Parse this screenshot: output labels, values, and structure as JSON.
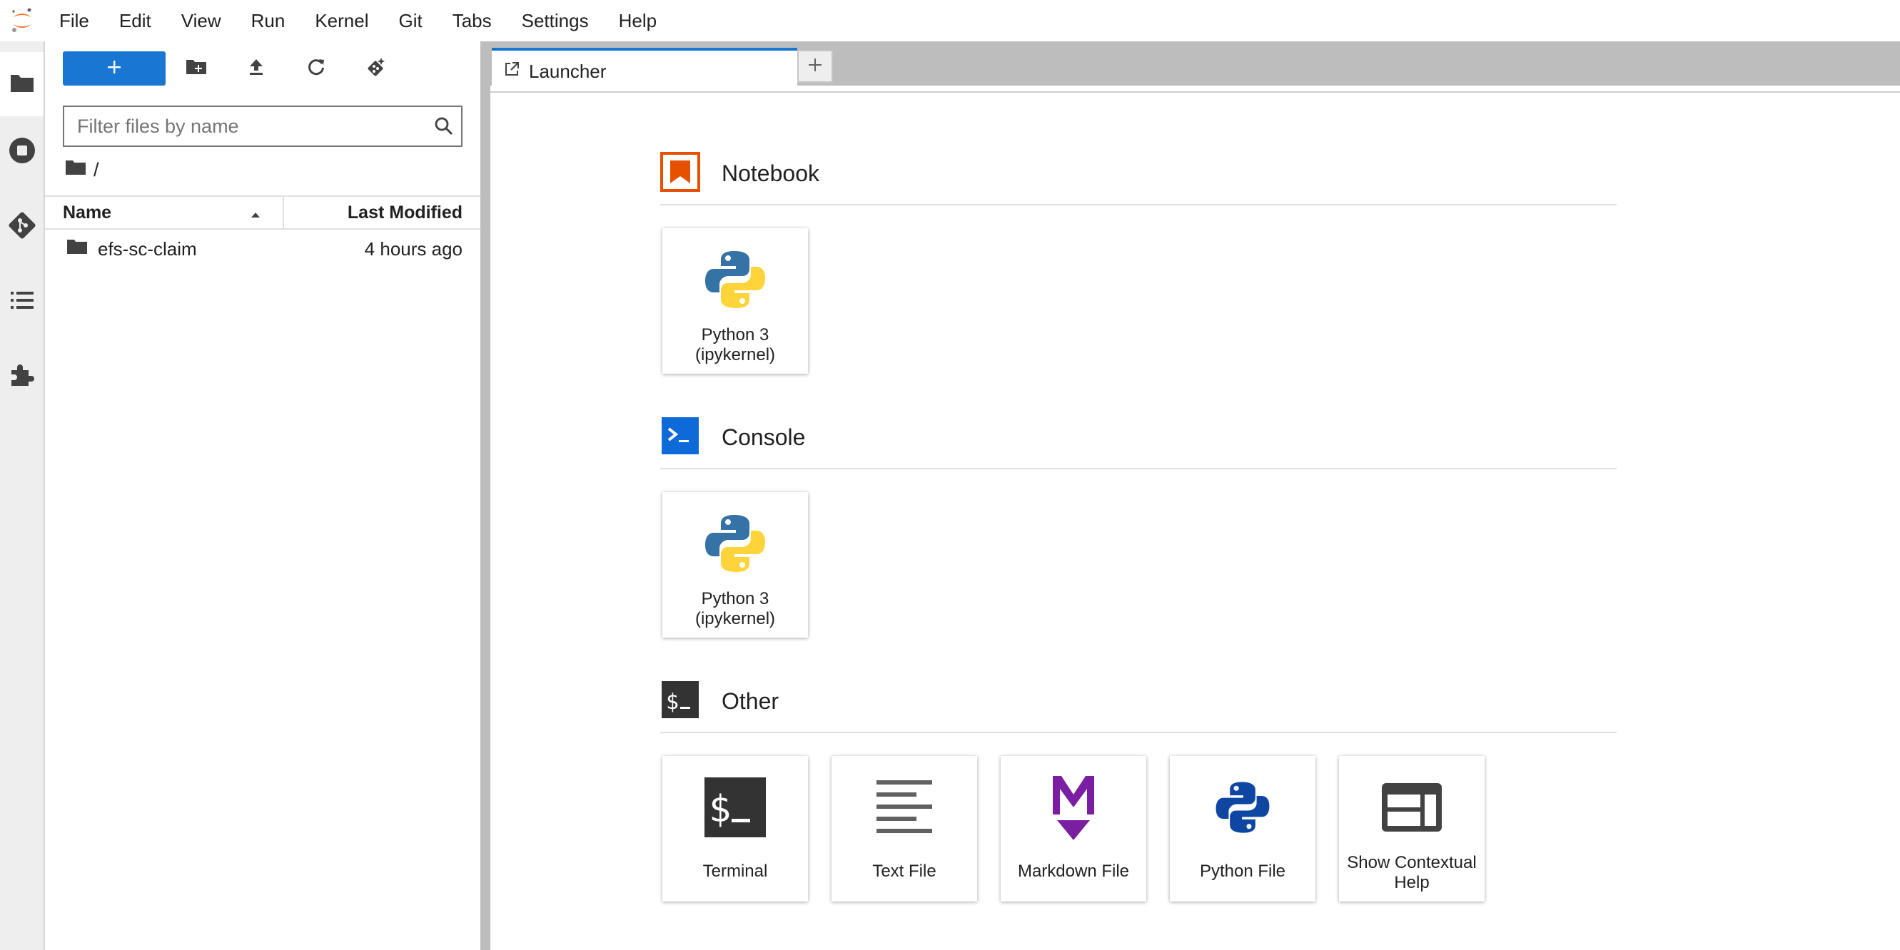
{
  "menu": {
    "items": [
      "File",
      "Edit",
      "View",
      "Run",
      "Kernel",
      "Git",
      "Tabs",
      "Settings",
      "Help"
    ]
  },
  "activity_bar": {
    "icons": [
      "folder-icon",
      "running-icon",
      "git-icon",
      "toc-icon",
      "extensions-icon"
    ]
  },
  "file_browser": {
    "filter_placeholder": "Filter files by name",
    "breadcrumb": "/",
    "columns": {
      "name": "Name",
      "modified": "Last Modified"
    },
    "sort": "name-ascending",
    "rows": [
      {
        "name": "efs-sc-claim",
        "type": "folder",
        "modified": "4 hours ago"
      }
    ]
  },
  "tabs": [
    {
      "label": "Launcher",
      "active": true
    }
  ],
  "launcher": {
    "sections": [
      {
        "title": "Notebook",
        "icon": "notebook-icon",
        "cards": [
          {
            "label": "Python 3 (ipykernel)",
            "icon": "python-logo-icon"
          }
        ]
      },
      {
        "title": "Console",
        "icon": "console-icon",
        "cards": [
          {
            "label": "Python 3 (ipykernel)",
            "icon": "python-logo-icon"
          }
        ]
      },
      {
        "title": "Other",
        "icon": "terminal-section-icon",
        "cards": [
          {
            "label": "Terminal",
            "icon": "terminal-icon"
          },
          {
            "label": "Text File",
            "icon": "text-file-icon"
          },
          {
            "label": "Markdown File",
            "icon": "markdown-icon"
          },
          {
            "label": "Python File",
            "icon": "python-file-icon"
          },
          {
            "label": "Show Contextual Help",
            "icon": "contextual-help-icon"
          }
        ]
      }
    ]
  },
  "colors": {
    "accent": "#1976d2",
    "notebook": "#e65100",
    "console": "#0d6ad8",
    "markdown": "#7b1fa2",
    "python_blue": "#0d47a1"
  }
}
